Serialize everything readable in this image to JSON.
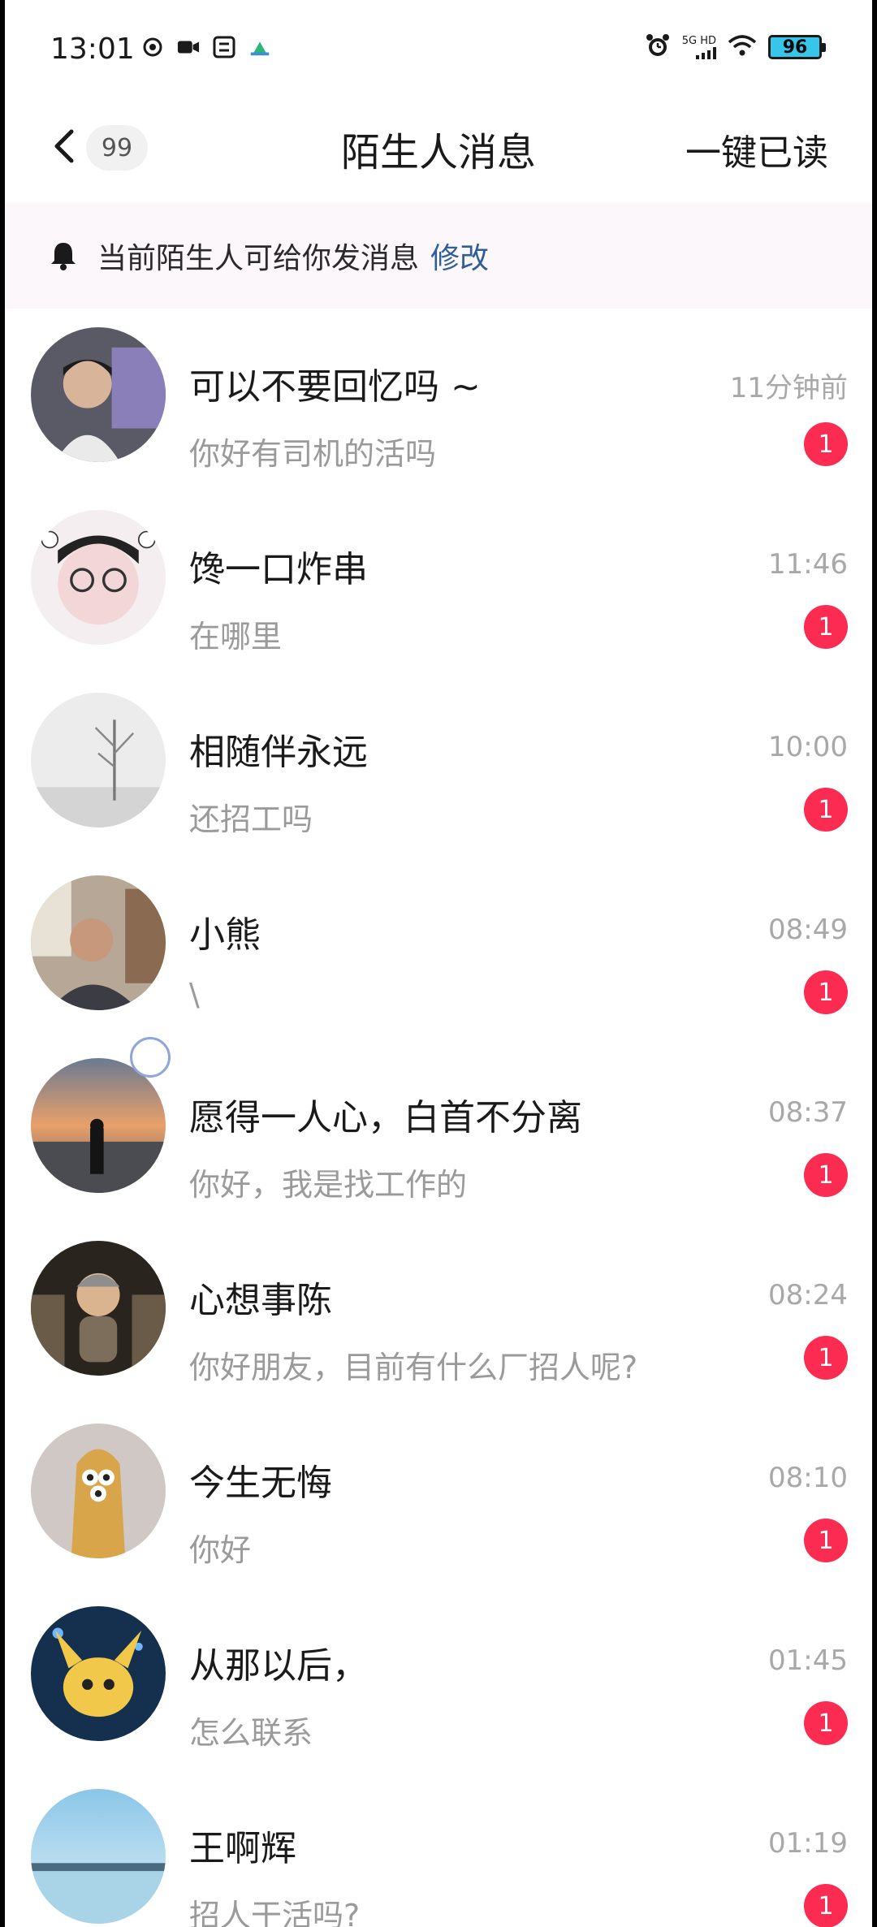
{
  "status_bar": {
    "time": "13:01",
    "network": "5G HD",
    "battery": "96",
    "icons_left": [
      "swirl-icon",
      "video-icon",
      "app-icon",
      "cloud-icon"
    ],
    "icons_right": [
      "alarm-icon",
      "signal-icon",
      "wifi-icon",
      "battery-icon"
    ]
  },
  "header": {
    "title": "陌生人消息",
    "unread_badge": "99",
    "action": "一键已读"
  },
  "notice": {
    "text": "当前陌生人可给你发消息",
    "link": "修改"
  },
  "colors": {
    "unread_badge": "#fb2b52",
    "link": "#2f5f96",
    "notice_bg": "#fbf7fa",
    "battery_fill": "#38c5ea"
  },
  "conversations": [
    {
      "name": "可以不要回忆吗 ~",
      "preview": "你好有司机的活吗",
      "time": "11分钟前",
      "unread": "1"
    },
    {
      "name": "馋一口炸串",
      "preview": "在哪里",
      "time": "11:46",
      "unread": "1"
    },
    {
      "name": "相随伴永远",
      "preview": "还招工吗",
      "time": "10:00",
      "unread": "1"
    },
    {
      "name": "小熊",
      "preview": "\\",
      "time": "08:49",
      "unread": "1"
    },
    {
      "name": "愿得一人心，白首不分离",
      "preview": "你好，我是找工作的",
      "time": "08:37",
      "unread": "1"
    },
    {
      "name": "心想事陈",
      "preview": "你好朋友，目前有什么厂招人呢?",
      "time": "08:24",
      "unread": "1"
    },
    {
      "name": "今生无悔",
      "preview": "你好",
      "time": "08:10",
      "unread": "1"
    },
    {
      "name": "从那以后，",
      "preview": "怎么联系",
      "time": "01:45",
      "unread": "1"
    },
    {
      "name": "王啊辉",
      "preview": "招人干活吗?",
      "time": "01:19",
      "unread": "1"
    }
  ]
}
